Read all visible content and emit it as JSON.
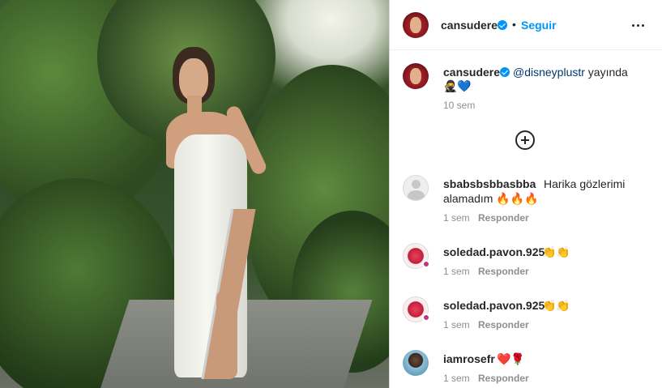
{
  "post": {
    "author": "cansudere",
    "follow_label": "Seguir",
    "separator": "•",
    "caption_user": "cansudere",
    "caption_mention": "@disneyplustr",
    "caption_rest": " yayında",
    "caption_emojis": "🥷💙",
    "caption_time": "10 sem",
    "load_more_icon": "plus-circle-icon",
    "accent_color": "#0095f6"
  },
  "comments": [
    {
      "user": "sbabsbsbbasbba",
      "text_line1": "Harika gözlerimi",
      "text_line2": "alamadım 🔥🔥🔥",
      "time": "1 sem",
      "reply": "Responder",
      "avatar": "default-avatar"
    },
    {
      "user": "soledad.pavon.925",
      "text": "👏👏",
      "time": "1 sem",
      "reply": "Responder",
      "avatar": "rose-avatar"
    },
    {
      "user": "soledad.pavon.925",
      "text": "👏👏",
      "time": "1 sem",
      "reply": "Responder",
      "avatar": "rose-avatar"
    },
    {
      "user": "iamrosefr",
      "text": "❤️🌹",
      "time": "1 sem",
      "reply": "Responder",
      "avatar": "person-avatar"
    }
  ]
}
